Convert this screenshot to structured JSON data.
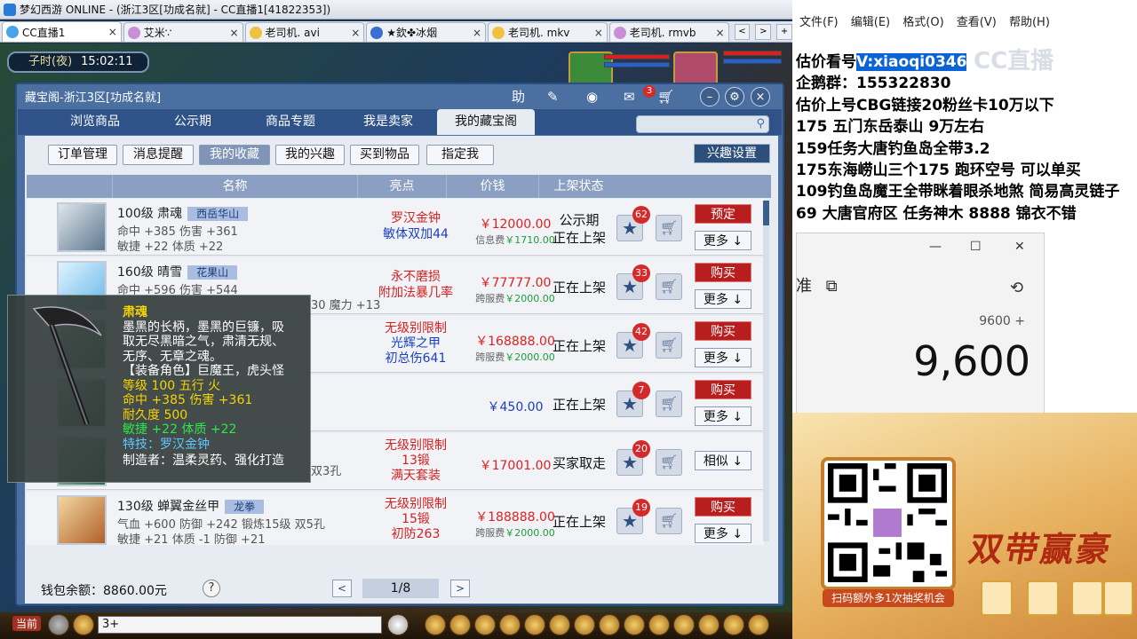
{
  "window": {
    "title": "梦幻西游 ONLINE - (浙江3区[功成名就] - CC直播1[41822353])",
    "close": "×"
  },
  "browser_tabs": [
    {
      "label": "CC直播1"
    },
    {
      "label": "艾米∵"
    },
    {
      "label": "老司机. avi"
    },
    {
      "label": "★欽✤冰烟"
    },
    {
      "label": "老司机. mkv"
    },
    {
      "label": "老司机. rmvb"
    }
  ],
  "tab_nav": {
    "prev": "<",
    "next": ">",
    "add": "+"
  },
  "game": {
    "time_period": "子时(夜)",
    "time": "15:02:11"
  },
  "window_header": {
    "title": "藏宝阁-浙江3区[功成名就]",
    "help": "助",
    "mail_count": "3"
  },
  "main_tabs": [
    "浏览商品",
    "公示期",
    "商品专题",
    "我是卖家",
    "我的藏宝阁"
  ],
  "sub_tabs": [
    "订单管理",
    "消息提醒",
    "我的收藏",
    "我的兴趣",
    "买到物品",
    "指定我"
  ],
  "interest_settings": "兴趣设置",
  "table_headers": {
    "name": "名称",
    "highlight": "亮点",
    "price": "价钱",
    "status": "上架状态"
  },
  "items": [
    {
      "name": "100级 肃魂",
      "school": "西岳华山",
      "stat1": "命中 +385 伤害 +361",
      "stat2": "敏捷 +22 体质 +22",
      "hl1": "罗汉金钟",
      "hl2": "敏体双加44",
      "price": "￥12000.00",
      "fee_label": "信息费",
      "fee": "￥1710.00",
      "status": "公示期",
      "status2": "正在上架",
      "favs": "62",
      "action": "预定",
      "more": "更多 ↓"
    },
    {
      "name": "160级 晴雪",
      "school": "花果山",
      "stat1": "命中 +596 伤害 +544",
      "stat2": "",
      "hl1": "永不磨损",
      "hl2": "附加法暴几率",
      "price": "￥77777.00",
      "fee_label": "跨服费",
      "fee": "￥2000.00",
      "status": "正在上架",
      "status2": "",
      "favs": "33",
      "action": "购买",
      "more": "更多 ↓"
    },
    {
      "name": "",
      "school": "",
      "stat1": "",
      "stat2": "",
      "hl1": "无级别限制",
      "hl2": "光辉之甲",
      "hl3": "初总伤641",
      "price": "￥168888.00",
      "fee_label": "跨服费",
      "fee": "￥2000.00",
      "status": "正在上架",
      "status2": "",
      "favs": "42",
      "action": "购买",
      "more": "更多 ↓"
    },
    {
      "name": "",
      "school": "",
      "stat1": "",
      "stat2": "",
      "hl1": "",
      "hl2": "",
      "price": "￥450.00",
      "fee_label": "",
      "fee": "",
      "status": "正在上架",
      "status2": "",
      "favs": "7",
      "action": "购买",
      "more": "更多 ↓"
    },
    {
      "name": "",
      "school": "",
      "stat1": "",
      "stat2": "",
      "hl1": "无级别限制",
      "hl2": "13锻",
      "hl3": "满天套装",
      "price": "￥17001.00",
      "fee_label": "",
      "fee": "",
      "status": "买家取走",
      "status2": "",
      "favs": "20",
      "action": "",
      "more": "相似 ↓"
    },
    {
      "name": "130级 蝉翼金丝甲",
      "school": "龙拳",
      "stat1": "气血 +600 防御 +242 锻炼15级 双5孔",
      "stat2": "敏捷 +21 体质 -1 防御 +21",
      "hl1": "无级别限制",
      "hl2": "15锻",
      "hl3": "初防263",
      "price": "￥188888.00",
      "fee_label": "跨服费",
      "fee": "￥2000.00",
      "status": "正在上架",
      "status2": "",
      "favs": "19",
      "action": "购买",
      "more": "更多 ↓"
    }
  ],
  "partial_stats": {
    "row2_peek": "30 魔力 +13",
    "row5_peek": "双3孔"
  },
  "tooltip": {
    "title": "肃魂",
    "desc1": "墨黑的长柄，墨黑的巨镰，吸",
    "desc2": "取无尽黑暗之气，肃清无规、",
    "desc3": "无序、无章之魂。",
    "role": "【装备角色】巨魔王，虎头怪",
    "level": "等级 100  五行 火",
    "stat": "命中 +385 伤害 +361",
    "durability": "耐久度 500",
    "bonus": "敏捷 +22 体质 +22",
    "special": "特技：罗汉金钟",
    "maker": "制造者：温柔灵药、强化打造"
  },
  "footer": {
    "wallet": "钱包余额：8860.00元",
    "help": "?",
    "page": "1/8",
    "prev": "<",
    "next": ">"
  },
  "chat": {
    "channel": "当前",
    "input": "3+"
  },
  "notepad": {
    "menu": [
      "文件(F)",
      "编辑(E)",
      "格式(O)",
      "查看(V)",
      "帮助(H)"
    ],
    "line1_pre": "估价看号",
    "line1_sel": "V:xiaoqi0346",
    "lines": [
      "企鹅群：155322830",
      "估价上号CBG链接20粉丝卡10万以下",
      "175 五门东岳泰山  9万左右",
      "159任务大唐钓鱼岛全带3.2",
      "175东海崂山三个175 跑环空号 可以单买",
      "109钓鱼岛魔王全带眯着眼杀地煞 简易高灵链子",
      "69  大唐官府区 任务神木 8888 锦衣不错"
    ],
    "watermark": "CC直播"
  },
  "calculator": {
    "mode_icon": "⧉",
    "expression": "9600 +",
    "value": "9,600",
    "minimize": "—",
    "maximize": "☐",
    "close": "✕",
    "history": "⟲",
    "mode": "准"
  },
  "promo": {
    "qr_caption": "扫码额外多1次抽奖机会",
    "slogan": "双带赢豪"
  }
}
